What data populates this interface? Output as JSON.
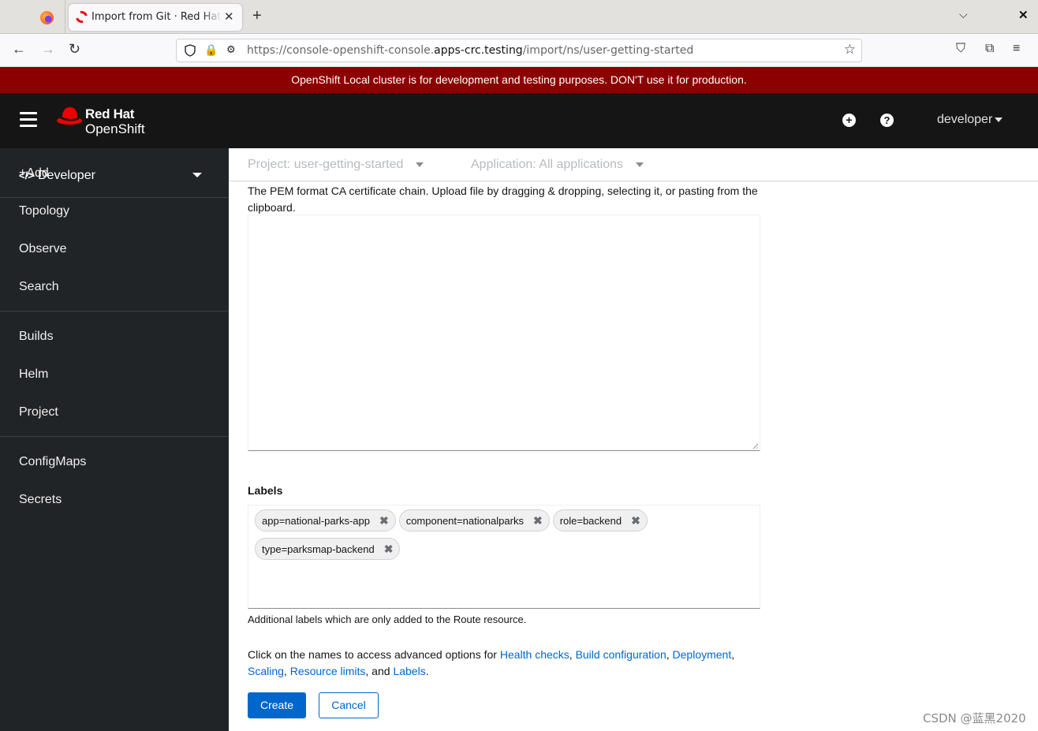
{
  "browser": {
    "tab_title": "Import from Git · Red Hat OpenShift",
    "new_tab_label": "+",
    "url_prefix": "https://console-openshift-console.",
    "url_host": "apps-crc.testing",
    "url_path": "/import/ns/user-getting-started",
    "icons": {
      "firefox": "firefox-logo-icon",
      "tab": "openshift-sync-icon",
      "back": "←",
      "forward": "→",
      "reload": "↻",
      "shield": "shield-icon",
      "lock": "🔒",
      "permissions": "⚙",
      "bookmark": "☆",
      "pocket": "⛉",
      "extensions": "⧉",
      "menu": "≡",
      "tabs_list": "⌵",
      "close": "✕"
    }
  },
  "banner": {
    "text": "OpenShift Local cluster is for development and testing purposes. DON'T use it for production.",
    "color": "#8b0000"
  },
  "masthead": {
    "brand_line1": "Red Hat",
    "brand_line2": "OpenShift",
    "add_icon": "+",
    "help_icon": "?",
    "user": "developer"
  },
  "sidebar": {
    "perspective": "Developer",
    "perspective_icon": "</>",
    "groups": [
      {
        "items": [
          {
            "label": "+Add"
          },
          {
            "label": "Topology"
          },
          {
            "label": "Observe"
          },
          {
            "label": "Search"
          }
        ]
      },
      {
        "items": [
          {
            "label": "Builds"
          },
          {
            "label": "Helm"
          },
          {
            "label": "Project"
          }
        ]
      },
      {
        "items": [
          {
            "label": "ConfigMaps"
          },
          {
            "label": "Secrets"
          }
        ]
      }
    ]
  },
  "context_bar": {
    "project": "Project: user-getting-started",
    "application": "Application: All applications"
  },
  "form": {
    "ca_cert_helper": "The PEM format CA certificate chain. Upload file by dragging & dropping, selecting it, or pasting from the clipboard.",
    "ca_cert_value": "",
    "labels_title": "Labels",
    "labels": [
      "app=national-parks-app",
      "component=nationalparks",
      "role=backend",
      "type=parksmap-backend"
    ],
    "labels_remove_icon": "✖",
    "labels_helper": "Additional labels which are only added to the Route resource.",
    "advanced": {
      "prefix": "Click on the names to access advanced options for ",
      "links": [
        "Health checks",
        "Build configuration",
        "Deployment",
        "Scaling",
        "Resource limits",
        "Labels"
      ],
      "sep": ", ",
      "and": ", and ",
      "end": "."
    },
    "create_label": "Create",
    "cancel_label": "Cancel",
    "primary_color": "#0066cc"
  },
  "watermark": "CSDN @蓝黑2020"
}
